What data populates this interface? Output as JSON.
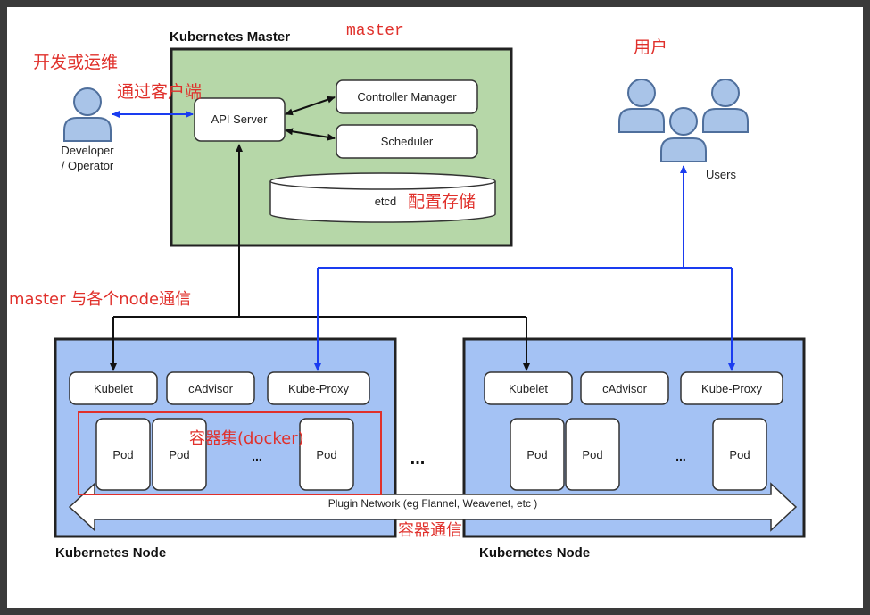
{
  "master": {
    "title": "Kubernetes Master",
    "api_server": "API Server",
    "controller_manager": "Controller Manager",
    "scheduler": "Scheduler",
    "etcd": "etcd"
  },
  "developer": {
    "label_line1": "Developer",
    "label_line2": "/ Operator"
  },
  "users": {
    "label": "Users"
  },
  "nodes": [
    {
      "title": "Kubernetes Node",
      "components": [
        "Kubelet",
        "cAdvisor",
        "Kube-Proxy"
      ],
      "pods": [
        "Pod",
        "Pod",
        "Pod"
      ],
      "ellipsis": "..."
    },
    {
      "title": "Kubernetes Node",
      "components": [
        "Kubelet",
        "cAdvisor",
        "Kube-Proxy"
      ],
      "pods": [
        "Pod",
        "Pod",
        "Pod"
      ],
      "ellipsis": "..."
    }
  ],
  "between_nodes": "...",
  "plugin_network": "Plugin Network (eg Flannel, Weavenet, etc )",
  "annotations": {
    "master": "master",
    "dev_ops": "开发或运维",
    "via_client": "通过客户端",
    "users_cn": "用户",
    "config_storage": "配置存储",
    "master_node_comm": "master 与各个node通信",
    "container_set": "容器集(docker)",
    "container_comm": "容器通信"
  },
  "colors": {
    "master_fill": "#b6d7a8",
    "node_fill": "#a4c2f4",
    "blue_line": "#1a3cf0",
    "annotation_red": "#e0302b"
  }
}
